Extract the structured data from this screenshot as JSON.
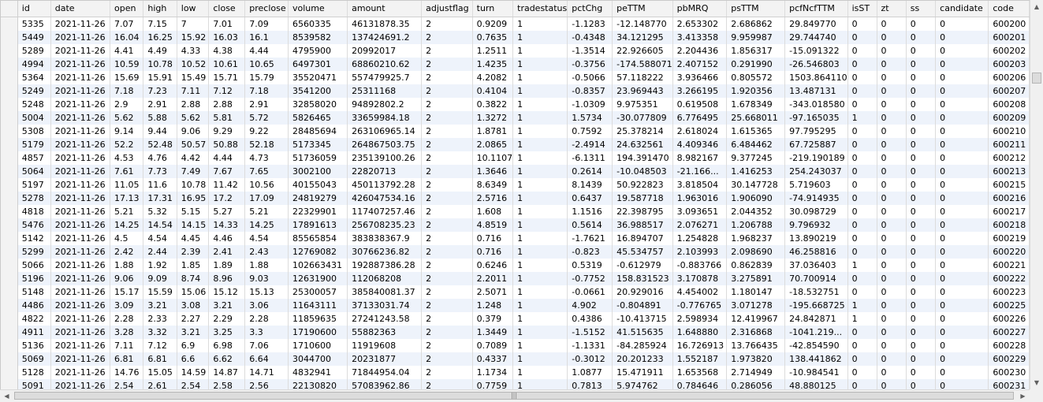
{
  "columns": [
    "id",
    "date",
    "open",
    "high",
    "low",
    "close",
    "preclose",
    "volume",
    "amount",
    "adjustflag",
    "turn",
    "tradestatus",
    "pctChg",
    "peTTM",
    "pbMRQ",
    "psTTM",
    "pcfNcfTTM",
    "isST",
    "zt",
    "ss",
    "candidate",
    "code"
  ],
  "rows": [
    [
      "5335",
      "2021-11-26",
      "7.07",
      "7.15",
      "7",
      "7.01",
      "7.09",
      "6560335",
      "46131878.35",
      "2",
      "0.9209",
      "1",
      "-1.1283",
      "-12.148770",
      "2.653302",
      "2.686862",
      "29.849770",
      "0",
      "0",
      "0",
      "0",
      "600200"
    ],
    [
      "5449",
      "2021-11-26",
      "16.04",
      "16.25",
      "15.92",
      "16.03",
      "16.1",
      "8539582",
      "137424691.2",
      "2",
      "0.7635",
      "1",
      "-0.4348",
      "34.121295",
      "3.413358",
      "9.959987",
      "29.744740",
      "0",
      "0",
      "0",
      "0",
      "600201"
    ],
    [
      "5289",
      "2021-11-26",
      "4.41",
      "4.49",
      "4.33",
      "4.38",
      "4.44",
      "4795900",
      "20992017",
      "2",
      "1.2511",
      "1",
      "-1.3514",
      "22.926605",
      "2.204436",
      "1.856317",
      "-15.091322",
      "0",
      "0",
      "0",
      "0",
      "600202"
    ],
    [
      "4994",
      "2021-11-26",
      "10.59",
      "10.78",
      "10.52",
      "10.61",
      "10.65",
      "6497301",
      "68860210.62",
      "2",
      "1.4235",
      "1",
      "-0.3756",
      "-174.588071",
      "2.407152",
      "0.291990",
      "-26.546803",
      "0",
      "0",
      "0",
      "0",
      "600203"
    ],
    [
      "5364",
      "2021-11-26",
      "15.69",
      "15.91",
      "15.49",
      "15.71",
      "15.79",
      "35520471",
      "557479925.7",
      "2",
      "4.2082",
      "1",
      "-0.5066",
      "57.118222",
      "3.936466",
      "0.805572",
      "1503.864110",
      "0",
      "0",
      "0",
      "0",
      "600206"
    ],
    [
      "5249",
      "2021-11-26",
      "7.18",
      "7.23",
      "7.11",
      "7.12",
      "7.18",
      "3541200",
      "25311168",
      "2",
      "0.4104",
      "1",
      "-0.8357",
      "23.969443",
      "3.266195",
      "1.920356",
      "13.487131",
      "0",
      "0",
      "0",
      "0",
      "600207"
    ],
    [
      "5248",
      "2021-11-26",
      "2.9",
      "2.91",
      "2.88",
      "2.88",
      "2.91",
      "32858020",
      "94892802.2",
      "2",
      "0.3822",
      "1",
      "-1.0309",
      "9.975351",
      "0.619508",
      "1.678349",
      "-343.018580",
      "0",
      "0",
      "0",
      "0",
      "600208"
    ],
    [
      "5004",
      "2021-11-26",
      "5.62",
      "5.88",
      "5.62",
      "5.81",
      "5.72",
      "5826465",
      "33659984.18",
      "2",
      "1.3272",
      "1",
      "1.5734",
      "-30.077809",
      "6.776495",
      "25.668011",
      "-97.165035",
      "1",
      "0",
      "0",
      "0",
      "600209"
    ],
    [
      "5308",
      "2021-11-26",
      "9.14",
      "9.44",
      "9.06",
      "9.29",
      "9.22",
      "28485694",
      "263106965.14",
      "2",
      "1.8781",
      "1",
      "0.7592",
      "25.378214",
      "2.618024",
      "1.615365",
      "97.795295",
      "0",
      "0",
      "0",
      "0",
      "600210"
    ],
    [
      "5179",
      "2021-11-26",
      "52.2",
      "52.48",
      "50.57",
      "50.88",
      "52.18",
      "5173345",
      "264867503.75",
      "2",
      "2.0865",
      "1",
      "-2.4914",
      "24.632561",
      "4.409346",
      "6.484462",
      "67.725887",
      "0",
      "0",
      "0",
      "0",
      "600211"
    ],
    [
      "4857",
      "2021-11-26",
      "4.53",
      "4.76",
      "4.42",
      "4.44",
      "4.73",
      "51736059",
      "235139100.26",
      "2",
      "10.1107",
      "1",
      "-6.1311",
      "194.391470",
      "8.982167",
      "9.377245",
      "-219.190189",
      "0",
      "0",
      "0",
      "0",
      "600212"
    ],
    [
      "5064",
      "2021-11-26",
      "7.61",
      "7.73",
      "7.49",
      "7.67",
      "7.65",
      "3002100",
      "22820713",
      "2",
      "1.3646",
      "1",
      "0.2614",
      "-10.048503",
      "-21.166...",
      "1.416253",
      "254.243037",
      "0",
      "0",
      "0",
      "0",
      "600213"
    ],
    [
      "5197",
      "2021-11-26",
      "11.05",
      "11.6",
      "10.78",
      "11.42",
      "10.56",
      "40155043",
      "450113792.28",
      "2",
      "8.6349",
      "1",
      "8.1439",
      "50.922823",
      "3.818504",
      "30.147728",
      "5.719603",
      "0",
      "0",
      "0",
      "0",
      "600215"
    ],
    [
      "5278",
      "2021-11-26",
      "17.13",
      "17.31",
      "16.95",
      "17.2",
      "17.09",
      "24819279",
      "426047534.16",
      "2",
      "2.5716",
      "1",
      "0.6437",
      "19.587718",
      "1.963016",
      "1.906090",
      "-74.914935",
      "0",
      "0",
      "0",
      "0",
      "600216"
    ],
    [
      "4818",
      "2021-11-26",
      "5.21",
      "5.32",
      "5.15",
      "5.27",
      "5.21",
      "22329901",
      "117407257.46",
      "2",
      "1.608",
      "1",
      "1.1516",
      "22.398795",
      "3.093651",
      "2.044352",
      "30.098729",
      "0",
      "0",
      "0",
      "0",
      "600217"
    ],
    [
      "5476",
      "2021-11-26",
      "14.25",
      "14.54",
      "14.15",
      "14.33",
      "14.25",
      "17891613",
      "256708235.23",
      "2",
      "4.8519",
      "1",
      "0.5614",
      "36.988517",
      "2.076271",
      "1.206788",
      "9.796932",
      "0",
      "0",
      "0",
      "0",
      "600218"
    ],
    [
      "5142",
      "2021-11-26",
      "4.5",
      "4.54",
      "4.45",
      "4.46",
      "4.54",
      "85565854",
      "383838367.9",
      "2",
      "0.716",
      "1",
      "-1.7621",
      "16.894707",
      "1.254828",
      "1.968237",
      "13.890219",
      "0",
      "0",
      "0",
      "0",
      "600219"
    ],
    [
      "5299",
      "2021-11-26",
      "2.42",
      "2.44",
      "2.39",
      "2.41",
      "2.43",
      "12769082",
      "30766236.82",
      "2",
      "0.716",
      "1",
      "-0.823",
      "45.534757",
      "2.103993",
      "2.098690",
      "46.258816",
      "0",
      "0",
      "0",
      "0",
      "600220"
    ],
    [
      "5066",
      "2021-11-26",
      "1.88",
      "1.92",
      "1.85",
      "1.89",
      "1.88",
      "102663431",
      "192887386.28",
      "2",
      "0.6246",
      "1",
      "0.5319",
      "-0.612979",
      "-0.883766",
      "0.862839",
      "37.036403",
      "1",
      "0",
      "0",
      "0",
      "600221"
    ],
    [
      "5196",
      "2021-11-26",
      "9.06",
      "9.09",
      "8.74",
      "8.96",
      "9.03",
      "12631900",
      "112068208",
      "2",
      "2.2011",
      "1",
      "-0.7752",
      "158.831523",
      "3.170878",
      "3.275891",
      "70.700914",
      "0",
      "0",
      "0",
      "0",
      "600222"
    ],
    [
      "5148",
      "2021-11-26",
      "15.17",
      "15.59",
      "15.06",
      "15.12",
      "15.13",
      "25300057",
      "385840081.37",
      "2",
      "2.5071",
      "1",
      "-0.0661",
      "20.929016",
      "4.454002",
      "1.180147",
      "-18.532751",
      "0",
      "0",
      "0",
      "0",
      "600223"
    ],
    [
      "4486",
      "2021-11-26",
      "3.09",
      "3.21",
      "3.08",
      "3.21",
      "3.06",
      "11643111",
      "37133031.74",
      "2",
      "1.248",
      "1",
      "4.902",
      "-0.804891",
      "-0.776765",
      "3.071278",
      "-195.668725",
      "1",
      "0",
      "0",
      "0",
      "600225"
    ],
    [
      "4822",
      "2021-11-26",
      "2.28",
      "2.33",
      "2.27",
      "2.29",
      "2.28",
      "11859635",
      "27241243.58",
      "2",
      "0.379",
      "1",
      "0.4386",
      "-10.413715",
      "2.598934",
      "12.419967",
      "24.842871",
      "1",
      "0",
      "0",
      "0",
      "600226"
    ],
    [
      "4911",
      "2021-11-26",
      "3.28",
      "3.32",
      "3.21",
      "3.25",
      "3.3",
      "17190600",
      "55882363",
      "2",
      "1.3449",
      "1",
      "-1.5152",
      "41.515635",
      "1.648880",
      "2.316868",
      "-1041.219...",
      "0",
      "0",
      "0",
      "0",
      "600227"
    ],
    [
      "5136",
      "2021-11-26",
      "7.11",
      "7.12",
      "6.9",
      "6.98",
      "7.06",
      "1710600",
      "11919608",
      "2",
      "0.7089",
      "1",
      "-1.1331",
      "-84.285924",
      "16.726913",
      "13.766435",
      "-42.854590",
      "0",
      "0",
      "0",
      "0",
      "600228"
    ],
    [
      "5069",
      "2021-11-26",
      "6.81",
      "6.81",
      "6.6",
      "6.62",
      "6.64",
      "3044700",
      "20231877",
      "2",
      "0.4337",
      "1",
      "-0.3012",
      "20.201233",
      "1.552187",
      "1.973820",
      "138.441862",
      "0",
      "0",
      "0",
      "0",
      "600229"
    ],
    [
      "5128",
      "2021-11-26",
      "14.76",
      "15.05",
      "14.59",
      "14.87",
      "14.71",
      "4832941",
      "71844954.04",
      "2",
      "1.1734",
      "1",
      "1.0877",
      "15.471911",
      "1.653568",
      "2.714949",
      "-10.984541",
      "0",
      "0",
      "0",
      "0",
      "600230"
    ],
    [
      "5091",
      "2021-11-26",
      "2.54",
      "2.61",
      "2.54",
      "2.58",
      "2.56",
      "22130820",
      "57083962.86",
      "2",
      "0.7759",
      "1",
      "0.7813",
      "5.974762",
      "0.784646",
      "0.286056",
      "48.880125",
      "0",
      "0",
      "0",
      "0",
      "600231"
    ]
  ],
  "scrollbars": {
    "v_up_icon": "arrow-up-icon",
    "v_down_icon": "arrow-down-icon",
    "h_left_icon": "arrow-left-icon",
    "h_right_icon": "arrow-right-icon"
  }
}
